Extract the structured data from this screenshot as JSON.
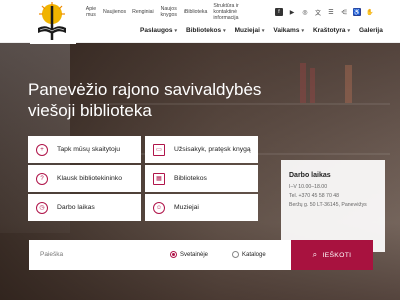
{
  "toplinks": [
    "Apie mus",
    "Naujienos",
    "Renginiai",
    "Naujos knygos",
    "iBiblioteka",
    "Struktūra ir kontaktinė informacija"
  ],
  "socials": [
    "facebook-icon",
    "youtube-icon",
    "instagram-icon",
    "translate-icon",
    "sitemap-icon",
    "share-icon",
    "accessibility-icon",
    "sign-language-icon"
  ],
  "nav": [
    "Paslaugos",
    "Bibliotekos",
    "Muziejai",
    "Vaikams",
    "Kraštotyra",
    "Galerija"
  ],
  "hero": {
    "line1": "Panevėžio rajono savivaldybės",
    "line2": "viešoji biblioteka"
  },
  "tiles": [
    {
      "label": "Tapk mūsų skaitytoju",
      "icon": "user-plus-icon"
    },
    {
      "label": "Užsisakyk, pratęsk knygą",
      "icon": "book-open-icon"
    },
    {
      "label": "Klausk bibliotekininko",
      "icon": "question-icon"
    },
    {
      "label": "Bibliotekos",
      "icon": "building-icon"
    },
    {
      "label": "Darbo laikas",
      "icon": "clock-icon"
    },
    {
      "label": "Muziejai",
      "icon": "chat-icon"
    }
  ],
  "hours": {
    "title": "Darbo laikas",
    "line1": "I–V 10.00–18.00",
    "line2": "Tel. +370 45 58 70 48",
    "line3": "Beržų g. 50 LT-36145, Panevėžys"
  },
  "search": {
    "placeholder": "Paieška",
    "option1": "Svetainėje",
    "option2": "Kataloge",
    "button": "IEŠKOTI"
  },
  "colors": {
    "accent": "#a8123f"
  }
}
